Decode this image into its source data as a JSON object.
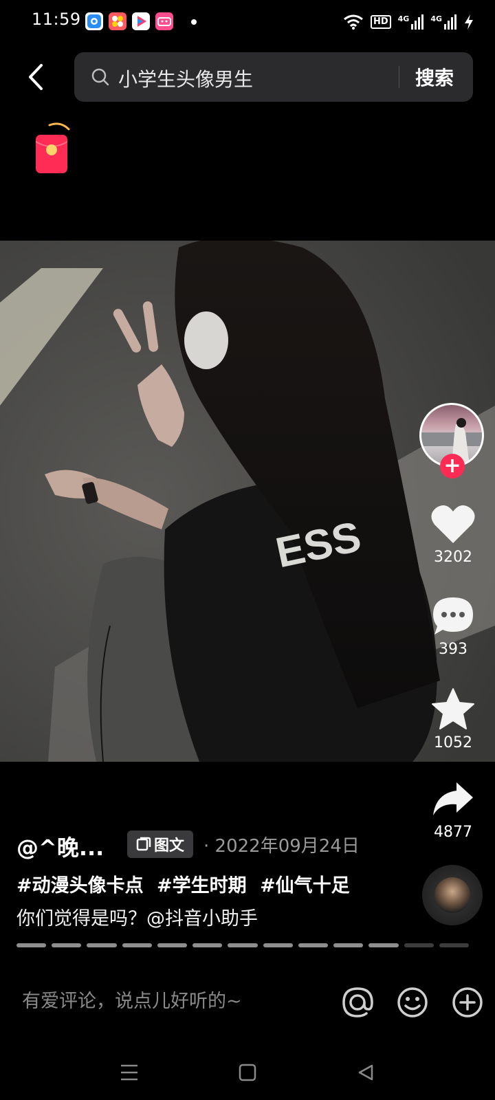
{
  "status_bar": {
    "time": "11:59",
    "network_1": "4G",
    "network_2": "4G",
    "hd_label": "HD"
  },
  "search": {
    "query": "小学生头像男生",
    "button_label": "搜索"
  },
  "post": {
    "shirt_print": "ESS",
    "author": "@^晚...",
    "type_chip": "图文",
    "date": "· 2022年09月24日",
    "hashtags": [
      "#动漫头像卡点",
      "#学生时期",
      "#仙气十足"
    ],
    "description": "你们觉得是吗？@抖音小助手"
  },
  "actions": {
    "like_count": "3202",
    "comment_count": "393",
    "favorite_count": "1052",
    "share_count": "4877"
  },
  "progress": {
    "total_segments": 13,
    "completed_segments": 11
  },
  "comment_bar": {
    "placeholder": "有爱评论，说点儿好听的~"
  },
  "colors": {
    "accent": "#fe2c55",
    "background": "#000000",
    "search_bg": "#2b2b2e"
  },
  "icons": {
    "back": "chevron-left-icon",
    "search": "search-icon",
    "red_packet": "red-packet-icon",
    "like": "heart-icon",
    "comment": "comment-bubble-icon",
    "favorite": "star-icon",
    "share": "share-arrow-icon",
    "mention": "at-sign-icon",
    "emoji": "smiley-icon",
    "add": "plus-circle-icon"
  }
}
